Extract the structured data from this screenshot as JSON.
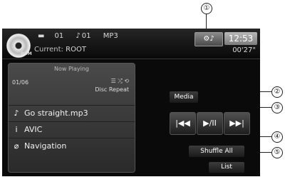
{
  "callouts": [
    "①",
    "②",
    "③",
    "④",
    "⑤"
  ],
  "header": {
    "disc_tag": "ROM",
    "folder_number": "01",
    "track_number": "01",
    "format": "MP3",
    "current_label": "Current:",
    "current_value": "ROOT",
    "clock": "12:53",
    "elapsed": "00'27\""
  },
  "now_playing": {
    "title": "Now Playing",
    "count": "01/06",
    "repeat_mode": "Disc Repeat",
    "song": "Go straight.mp3",
    "artist": "AVIC",
    "album": "Navigation"
  },
  "controls": {
    "media": "Media",
    "shuffle": "Shuffle All",
    "list": "List"
  },
  "icons": {
    "folder": "folder-icon",
    "note": "music-note-icon",
    "settings": "settings-icon",
    "prev": "skip-previous-icon",
    "play_pause": "play-pause-icon",
    "next": "skip-next-icon"
  }
}
